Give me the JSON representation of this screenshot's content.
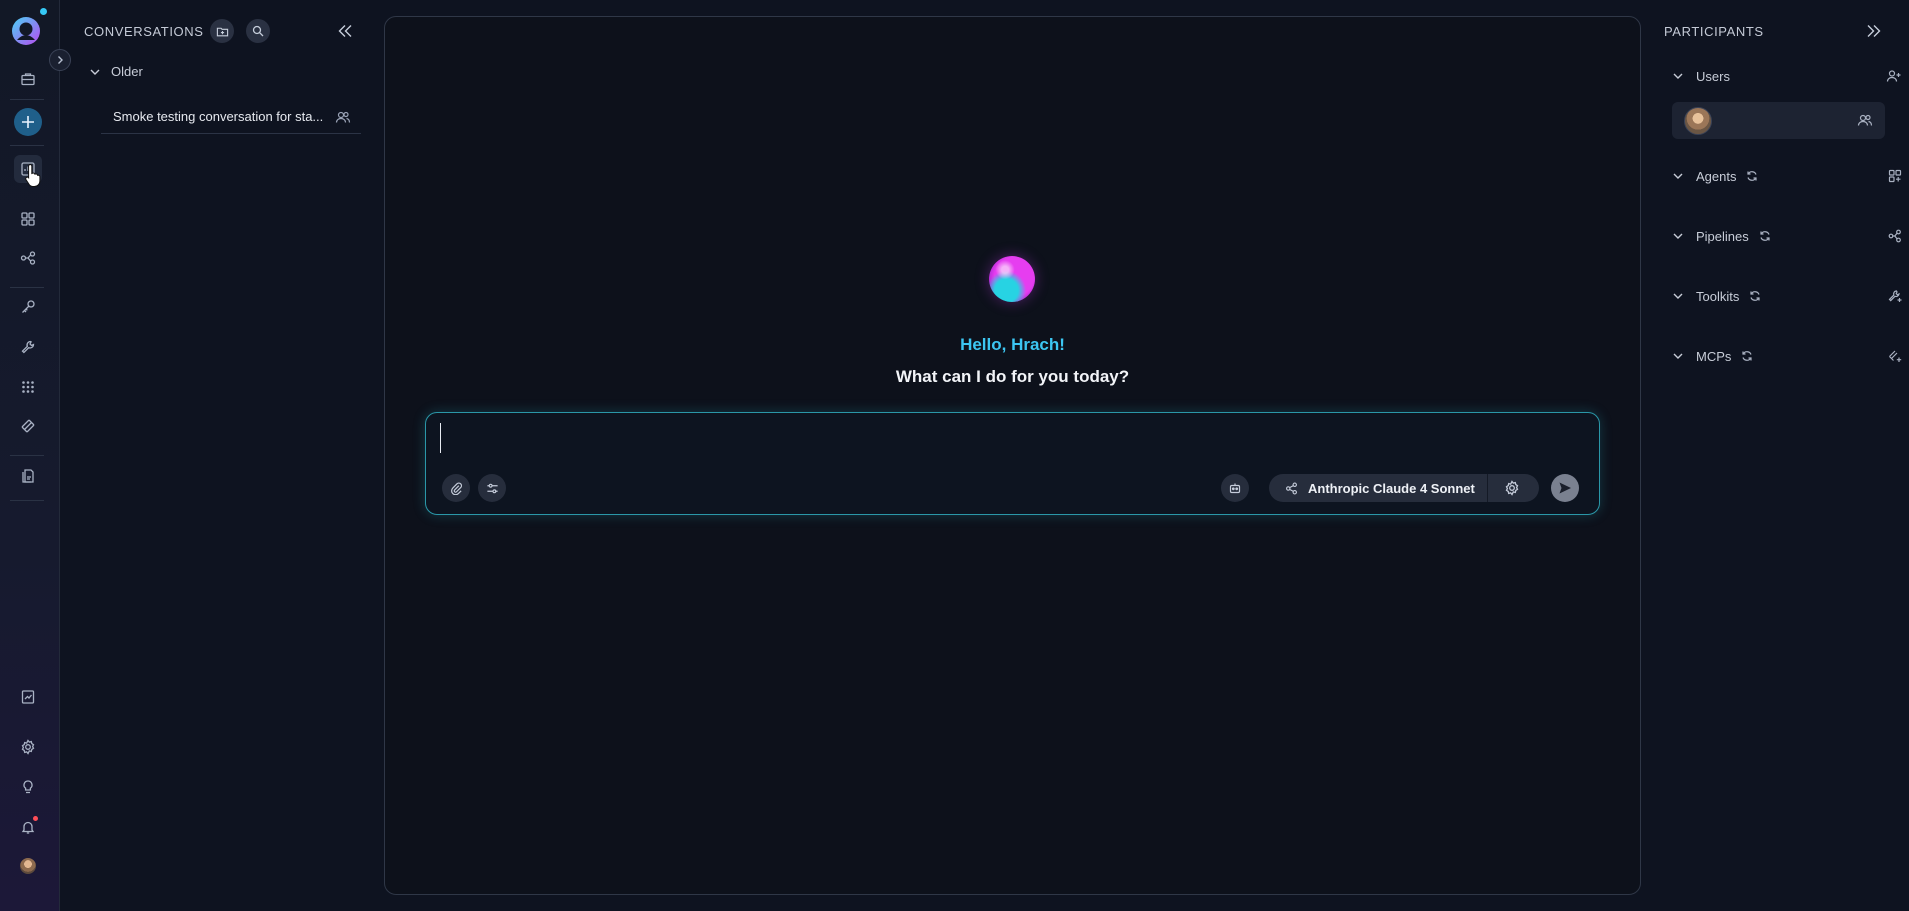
{
  "rail": {
    "icons": [
      "logo-icon",
      "briefcase-icon",
      "plus-icon",
      "chat-icon",
      "apps-icon",
      "pipeline-icon",
      "key-icon",
      "wrench-icon",
      "grid-icon",
      "mcp-icon",
      "artifact-icon",
      "report-icon",
      "settings-icon",
      "bulb-icon",
      "bell-icon",
      "avatar"
    ]
  },
  "conversations": {
    "title": "CONVERSATIONS",
    "group_label": "Older",
    "items": [
      {
        "title": "Smoke testing conversation for sta..."
      }
    ]
  },
  "main": {
    "greeting": "Hello, Hrach!",
    "subtitle": "What can I do for you today?",
    "composer": {
      "value": "",
      "placeholder": "",
      "model_label": "Anthropic Claude 4 Sonnet"
    }
  },
  "participants": {
    "title": "PARTICIPANTS",
    "sections": {
      "users": "Users",
      "agents": "Agents",
      "pipelines": "Pipelines",
      "toolkits": "Toolkits",
      "mcps": "MCPs"
    }
  },
  "colors": {
    "accent": "#3cc6f2",
    "background": "#0e1320",
    "composer_border": "#2a97a8",
    "notification": "#ff4d57"
  }
}
